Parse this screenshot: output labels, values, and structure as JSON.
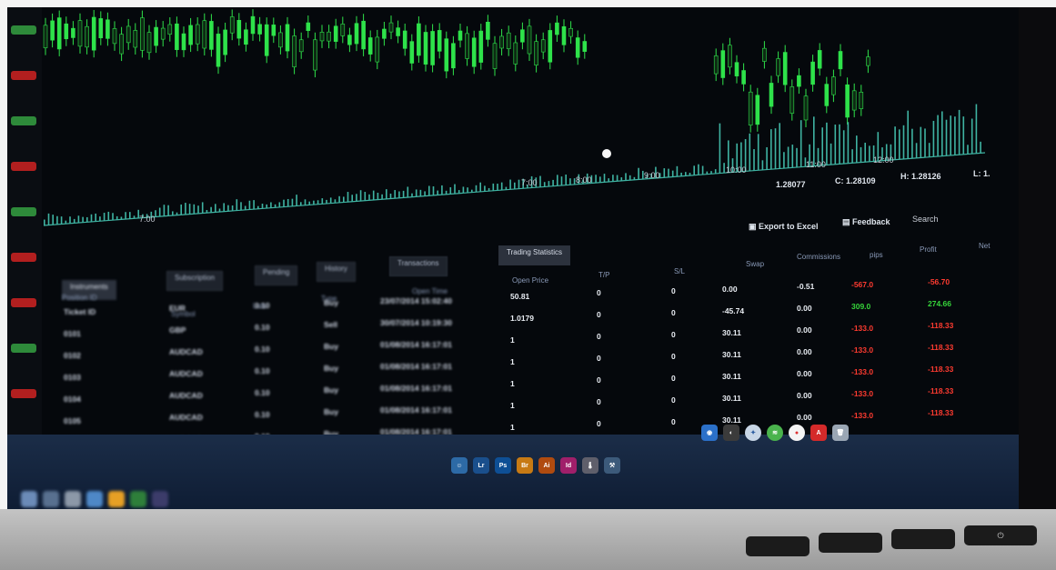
{
  "chart_header": {
    "time_labels": [
      "7:00",
      "8:00",
      "9:00",
      "10:00",
      "11:00",
      "12:00"
    ],
    "close_label": "C: 1.28109",
    "high_label": "H: 1.28126",
    "open_value": "1.28077",
    "low_label": "L: 1."
  },
  "toolbar": {
    "export_label": "Export to Excel",
    "feedback_label": "Feedback",
    "search_placeholder": "Search"
  },
  "tabs": [
    {
      "label": "Instruments"
    },
    {
      "label": "Subscription"
    },
    {
      "label": "Pending"
    },
    {
      "label": "History"
    },
    {
      "label": "Transactions"
    },
    {
      "label": "Trading Statistics"
    }
  ],
  "columns": [
    "Position ID",
    "Symbol",
    "Lots",
    "Type",
    "Open Time",
    "Open Price",
    "T/P",
    "S/L",
    "Swap",
    "Commissions",
    "pips",
    "Profit",
    "Net"
  ],
  "rows": [
    {
      "id": "Ticket ID",
      "sym": "EUR",
      "lots": "0.10",
      "type": "Buy",
      "time": "23/07/2014 15:02:40",
      "price": "50.81",
      "tp": "0",
      "sl": "0",
      "swap": "0.00",
      "comm": "-0.51",
      "pips": "-567.0",
      "profit": "-56.70"
    },
    {
      "id": "0101",
      "sym": "GBP",
      "lots": "0.10",
      "type": "Sell",
      "time": "30/07/2014 10:19:30",
      "price": "1.0179",
      "tp": "0",
      "sl": "0",
      "swap": "-45.74",
      "comm": "0.00",
      "pips": "309.0",
      "profit": "274.66"
    },
    {
      "id": "0102",
      "sym": "AUDCAD",
      "lots": "0.10",
      "type": "Buy",
      "time": "01/08/2014 16:17:01",
      "price": "1",
      "tp": "0",
      "sl": "0",
      "swap": "30.11",
      "comm": "0.00",
      "pips": "-133.0",
      "profit": "-118.33"
    },
    {
      "id": "0103",
      "sym": "AUDCAD",
      "lots": "0.10",
      "type": "Buy",
      "time": "01/08/2014 16:17:01",
      "price": "1",
      "tp": "0",
      "sl": "0",
      "swap": "30.11",
      "comm": "0.00",
      "pips": "-133.0",
      "profit": "-118.33"
    },
    {
      "id": "0104",
      "sym": "AUDCAD",
      "lots": "0.10",
      "type": "Buy",
      "time": "01/08/2014 16:17:01",
      "price": "1",
      "tp": "0",
      "sl": "0",
      "swap": "30.11",
      "comm": "0.00",
      "pips": "-133.0",
      "profit": "-118.33"
    },
    {
      "id": "0105",
      "sym": "AUDCAD",
      "lots": "0.10",
      "type": "Buy",
      "time": "01/08/2014 16:17:01",
      "price": "1",
      "tp": "0",
      "sl": "0",
      "swap": "30.11",
      "comm": "0.00",
      "pips": "-133.0",
      "profit": "-118.33"
    },
    {
      "id": "0106",
      "sym": "AUDCAD",
      "lots": "0.10",
      "type": "Buy",
      "time": "01/08/2014 16:17:01",
      "price": "1",
      "tp": "0",
      "sl": "0",
      "swap": "30.11",
      "comm": "0.00",
      "pips": "-133.0",
      "profit": "-118.33"
    }
  ],
  "dock": {
    "apps": [
      "Lr",
      "Ps",
      "Br",
      "Ai",
      "Id"
    ],
    "acrobat": "A"
  },
  "colors": {
    "candle_green": "#2ee24a",
    "volume_teal": "#3fb3a2",
    "loss_red": "#ff3b30",
    "gain_green": "#36d43a"
  }
}
